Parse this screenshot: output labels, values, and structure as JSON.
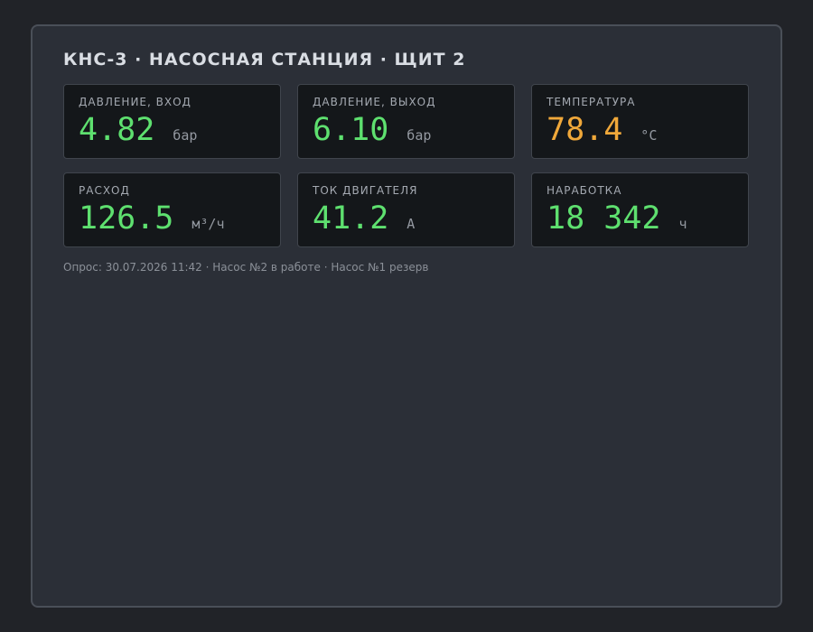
{
  "panel": {
    "title": "КНС-3 · НАСОСНАЯ СТАНЦИЯ · ЩИТ 2"
  },
  "colors": {
    "normal": "#5ee06f",
    "warning": "#f0a83a"
  },
  "tiles": [
    {
      "label": "ДАВЛЕНИЕ, ВХОД",
      "value": "4.82",
      "unit": "бар",
      "state": "normal"
    },
    {
      "label": "ДАВЛЕНИЕ, ВЫХОД",
      "value": "6.10",
      "unit": "бар",
      "state": "normal"
    },
    {
      "label": "ТЕМПЕРАТУРА",
      "value": "78.4",
      "unit": "°C",
      "state": "warning"
    },
    {
      "label": "РАСХОД",
      "value": "126.5",
      "unit": "м³/ч",
      "state": "normal"
    },
    {
      "label": "ТОК ДВИГАТЕЛЯ",
      "value": "41.2",
      "unit": "А",
      "state": "normal"
    },
    {
      "label": "НАРАБОТКА",
      "value": "18 342",
      "unit": "ч",
      "state": "normal"
    }
  ],
  "footer": {
    "text": "Опрос: 30.07.2026 11:42 · Насос №2 в работе · Насос №1 резерв"
  }
}
